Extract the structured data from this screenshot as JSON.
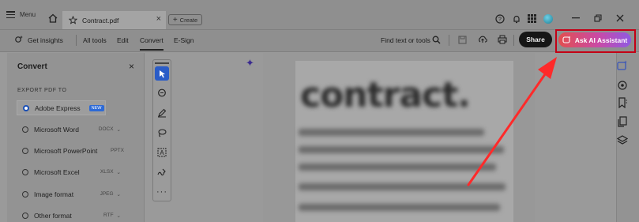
{
  "titlebar": {
    "menu_label": "Menu",
    "tab_title": "Contract.pdf",
    "create_label": "Create"
  },
  "toolbar": {
    "get_insights": "Get insights",
    "all_tools": "All tools",
    "edit": "Edit",
    "convert": "Convert",
    "esign": "E-Sign",
    "find_label": "Find text or tools",
    "share_label": "Share",
    "ai_label": "Ask AI Assistant"
  },
  "panel": {
    "title": "Convert",
    "section_label": "EXPORT PDF TO",
    "options": [
      {
        "label": "Adobe Express",
        "badge": "NEW",
        "format": "",
        "selected": true
      },
      {
        "label": "Microsoft Word",
        "format": "DOCX",
        "selected": false
      },
      {
        "label": "Microsoft PowerPoint",
        "format": "PPTX",
        "selected": false
      },
      {
        "label": "Microsoft Excel",
        "format": "XLSX",
        "selected": false
      },
      {
        "label": "Image format",
        "format": "JPEG",
        "selected": false
      },
      {
        "label": "Other format",
        "format": "RTF",
        "selected": false
      }
    ]
  },
  "document": {
    "heading": "contract."
  },
  "colors": {
    "ai_gradient_start": "#e24f4f",
    "ai_gradient_end": "#8f5ae3",
    "highlight_red": "#c40015",
    "selected_tool_blue": "#2a5cc7"
  },
  "icons": [
    "menu-icon",
    "home-icon",
    "star-icon",
    "help-icon",
    "bell-icon",
    "apps-icon",
    "avatar",
    "minimize-icon",
    "restore-icon",
    "close-icon",
    "insights-icon",
    "search-icon",
    "save-icon",
    "upload-icon",
    "print-icon",
    "ai-icon",
    "select-tool-icon",
    "comment-tool-icon",
    "draw-tool-icon",
    "lasso-tool-icon",
    "text-tool-icon",
    "sign-tool-icon",
    "more-icon",
    "sparkle-icon",
    "rail-ai-icon",
    "rail-comment-icon",
    "rail-bookmark-icon",
    "rail-pages-icon",
    "rail-layers-icon",
    "red-arrow"
  ]
}
